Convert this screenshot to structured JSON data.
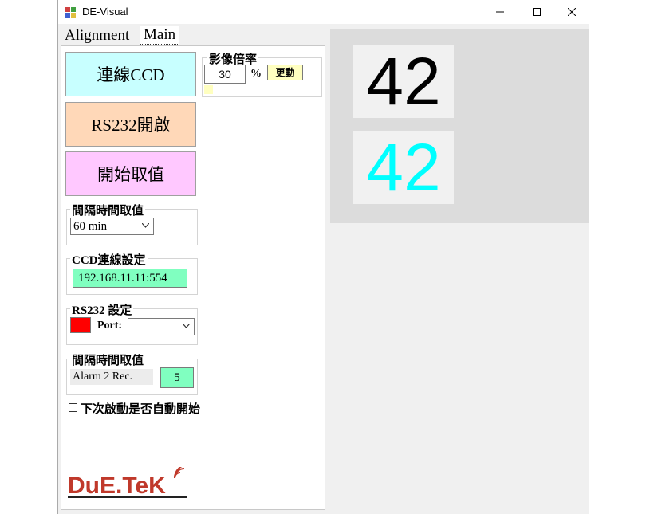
{
  "window": {
    "title": "DE-Visual"
  },
  "tabs": [
    {
      "label": "Alignment"
    },
    {
      "label": "Main"
    }
  ],
  "buttons": {
    "connect_ccd": "連線CCD",
    "rs232_open": "RS232開啟",
    "start_capture": "開始取值"
  },
  "colors": {
    "connect_ccd_bg": "#c8ffff",
    "rs232_open_bg": "#ffd8b8",
    "start_capture_bg": "#ffc8ff",
    "ip_field_bg": "#80ffc0",
    "alarm_field_bg": "#80ffc0",
    "status_indicator": "#ff0000",
    "update_button_bg": "#ffffc0",
    "value_top_color": "#000000",
    "value_bottom_color": "#00ffff"
  },
  "zoom": {
    "title": "影像倍率",
    "value": "30",
    "unit": "%",
    "update_label": "更動"
  },
  "interval": {
    "title": "間隔時間取值",
    "selected": "60 min"
  },
  "ccd": {
    "title": "CCD連線設定",
    "ip": "192.168.11.11:554"
  },
  "rs232": {
    "title": "RS232 設定",
    "port_label": "Port:",
    "port_value": ""
  },
  "alarm": {
    "title": "間隔時間取值",
    "label": "Alarm 2 Rec.",
    "value": "5"
  },
  "autostart": {
    "label": "下次啟動是否自動開始"
  },
  "display": {
    "value_top": "42",
    "value_bottom": "42"
  },
  "logo": {
    "text": "DuE.TeK"
  }
}
